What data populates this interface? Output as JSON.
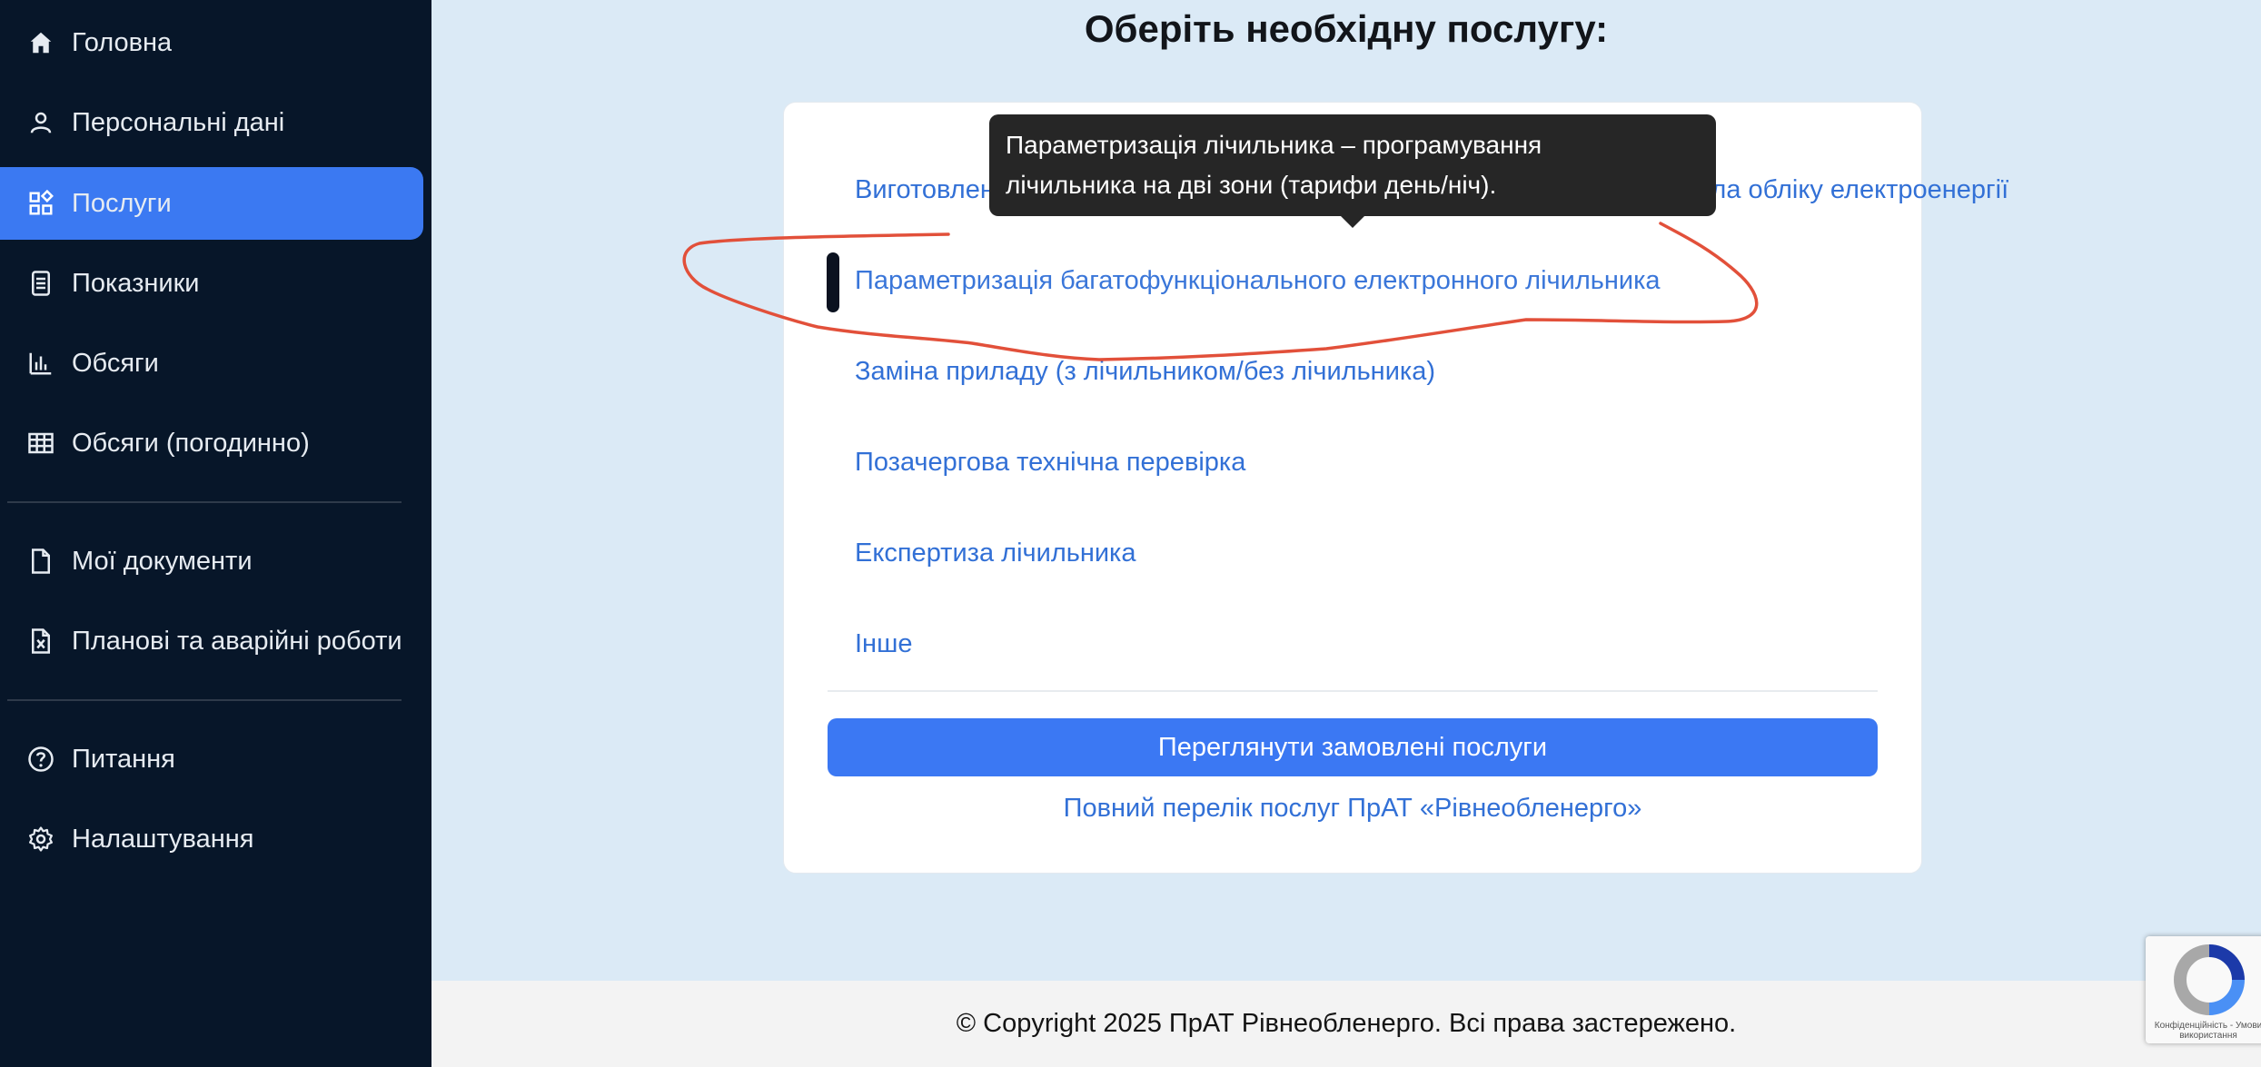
{
  "sidebar": {
    "items": [
      {
        "label": "Головна",
        "icon": "home-icon"
      },
      {
        "label": "Персональні дані",
        "icon": "user-icon"
      },
      {
        "label": "Послуги",
        "icon": "services-grid-icon",
        "active": true
      },
      {
        "label": "Показники",
        "icon": "readings-icon"
      },
      {
        "label": "Обсяги",
        "icon": "bar-chart-icon"
      },
      {
        "label": "Обсяги (погодинно)",
        "icon": "table-icon"
      },
      {
        "label": "Мої документи",
        "icon": "document-icon"
      },
      {
        "label": "Планові та аварійні роботи",
        "icon": "excel-file-icon"
      },
      {
        "label": "Питання",
        "icon": "question-icon"
      },
      {
        "label": "Налаштування",
        "icon": "gear-icon"
      }
    ]
  },
  "main": {
    "title": "Оберіть необхідну послугу:",
    "services": [
      "Виготовлення проектної документації на переобладнання (заміну) вузла обліку електроенергії",
      "Параметризація багатофункціонального електронного лічильника",
      "Заміна приладу (з лічильником/без лічильника)",
      "Позачергова технічна перевірка",
      "Експертиза лічильника",
      "Інше"
    ],
    "view_orders_button": "Переглянути замовлені послуги",
    "full_list_link": "Повний перелік послуг ПрАТ «Рівнеобленерго»"
  },
  "tooltip": {
    "line1": "Параметризація лічильника – програмування",
    "line2": "лічильника на дві зони (тарифи день/ніч)."
  },
  "footer": {
    "text": "© Copyright 2025 ПрАТ Рівнеобленерго. Всі права застережено."
  },
  "recaptcha": {
    "text": "Конфіденційність - Умови використання"
  },
  "colors": {
    "sidebar_bg": "#071629",
    "active_item": "#3b79f2",
    "link": "#3270d6",
    "page_bg": "#dbeaf6",
    "annotation": "#e2503a"
  }
}
